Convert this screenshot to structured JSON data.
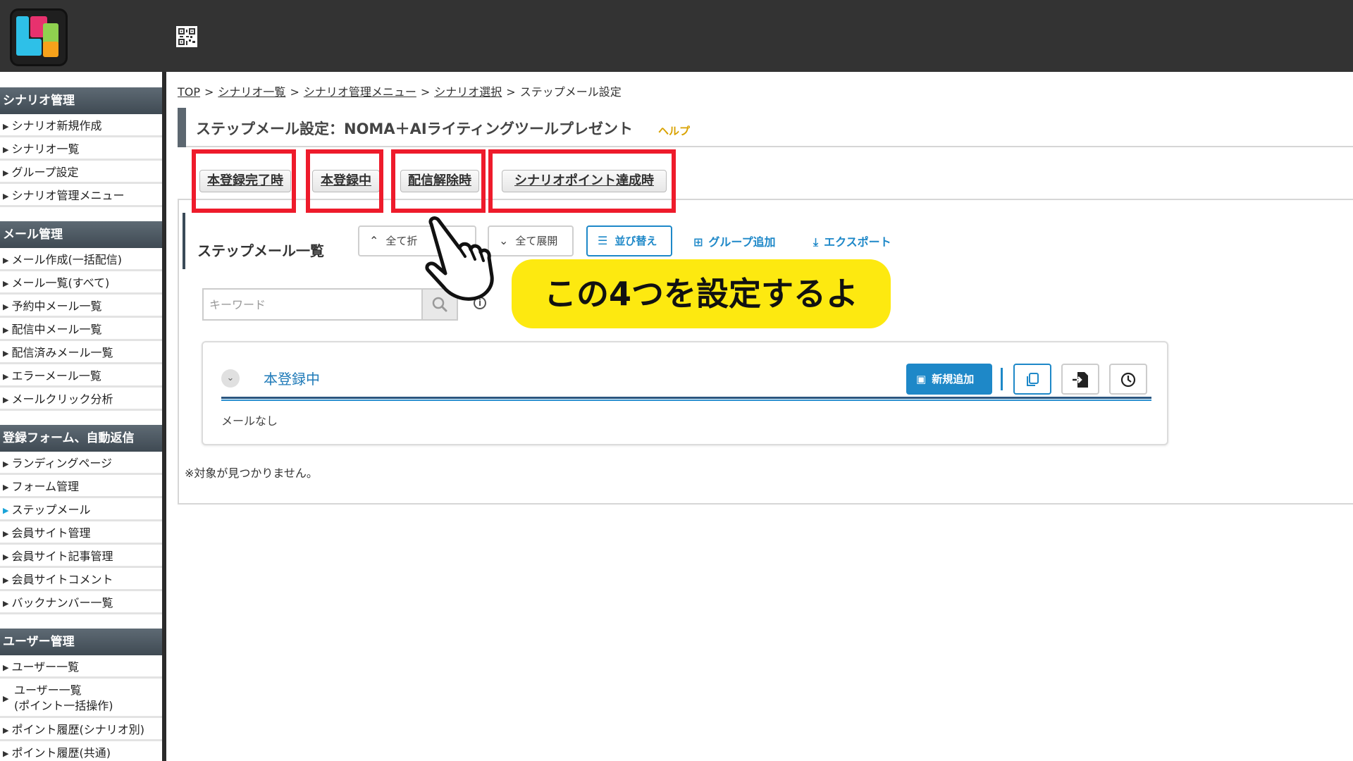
{
  "breadcrumb": {
    "items": [
      "TOP",
      "シナリオ一覧",
      "シナリオ管理メニュー",
      "シナリオ選択"
    ],
    "current": "ステップメール設定",
    "separator": ">"
  },
  "page": {
    "title": "ステップメール設定：NOMA＋AIライティングツールプレゼント",
    "help": "ヘルプ"
  },
  "tabs": [
    "本登録完了時",
    "本登録中",
    "配信解除時",
    "シナリオポイント達成時"
  ],
  "list": {
    "title": "ステップメール一覧",
    "collapse_all": "全て折",
    "expand_all": "全て展開",
    "sort": "並び替え",
    "add_group": "グループ追加",
    "export": "エクスポート",
    "keyword_placeholder": "キーワード"
  },
  "group": {
    "name": "本登録中",
    "add_new": "新規追加",
    "empty": "メールなし"
  },
  "not_found": "※対象が見つかりません。",
  "callout": "この4つを設定するよ",
  "sidebar": {
    "sections": [
      {
        "title": "シナリオ管理",
        "items": [
          "シナリオ新規作成",
          "シナリオ一覧",
          "グループ設定",
          "シナリオ管理メニュー"
        ]
      },
      {
        "title": "メール管理",
        "items": [
          "メール作成(一括配信)",
          "メール一覧(すべて)",
          "予約中メール一覧",
          "配信中メール一覧",
          "配信済みメール一覧",
          "エラーメール一覧",
          "メールクリック分析"
        ]
      },
      {
        "title": "登録フォーム、自動返信",
        "items": [
          "ランディングページ",
          "フォーム管理",
          "ステップメール",
          "会員サイト管理",
          "会員サイト記事管理",
          "会員サイトコメント",
          "バックナンバー一覧"
        ]
      },
      {
        "title": "ユーザー管理",
        "items": [
          "ユーザー一覧",
          "ユーザー一覧",
          "(ポイント一括操作)",
          "ポイント履歴(シナリオ別)",
          "ポイント履歴(共通)"
        ]
      }
    ]
  },
  "colors": {
    "header_bg": "#333333",
    "accent_blue": "#1e88c8",
    "highlight_red": "#ee1b2b",
    "callout_yellow": "#fde910",
    "help_gold": "#d9a200"
  }
}
